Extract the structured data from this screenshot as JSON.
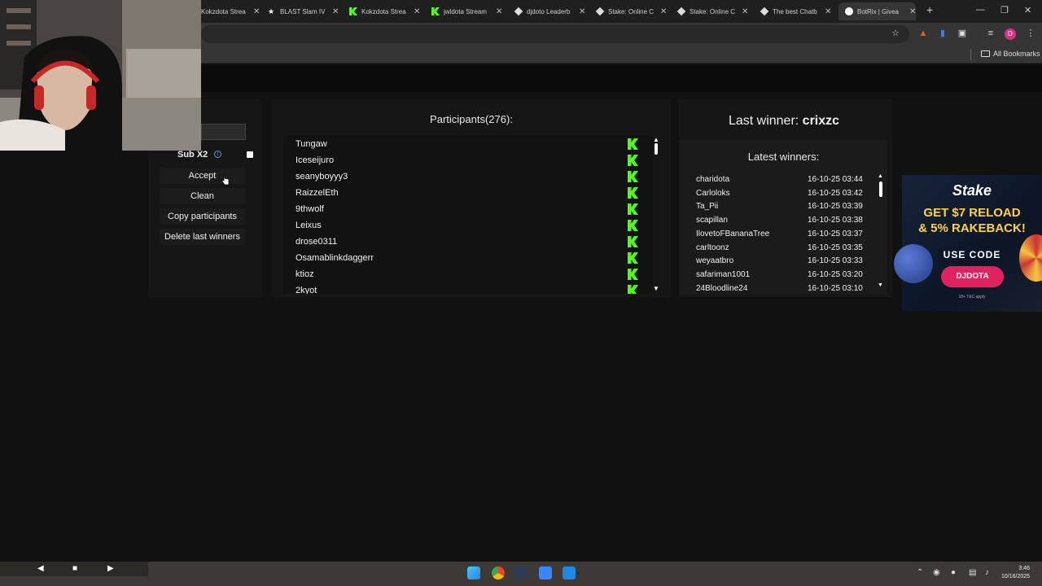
{
  "browser": {
    "tabs": [
      {
        "title": "Kokzdota Strea",
        "icon": "kick-icon"
      },
      {
        "title": "BLAST Slam IV",
        "icon": "blast-icon"
      },
      {
        "title": "Kokzdota Strea",
        "icon": "kick-icon"
      },
      {
        "title": "jwldota Stream",
        "icon": "kick-icon"
      },
      {
        "title": "djdoto Leaderb",
        "icon": "site-icon"
      },
      {
        "title": "Stake: Online C",
        "icon": "stake-icon"
      },
      {
        "title": "Stake: Online C",
        "icon": "stake-icon"
      },
      {
        "title": "The best Chatb",
        "icon": "site-icon"
      },
      {
        "title": "BotRix | Givea",
        "icon": "botrix-icon",
        "active": true
      }
    ],
    "new_tab": "+",
    "profile_initial": "D",
    "bookmarks_label": "All Bookmarks"
  },
  "controls": {
    "sub_x2_label": "Sub X2",
    "sub_x2_checked": true,
    "buttons": {
      "accept": "Accept",
      "clean": "Clean",
      "copy": "Copy participants",
      "delete": "Delete last winners"
    }
  },
  "participants": {
    "title": "Participants(276):",
    "names": [
      "Tungaw",
      "Iceseijuro",
      "seanyboyyy3",
      "RaizzelEth",
      "9thwolf",
      "Leixus",
      "drose0311",
      "Osamablinkdaggerr",
      "ktioz",
      "2kyot"
    ]
  },
  "winners": {
    "last_winner_label": "Last winner:",
    "last_winner_name": "crixzc",
    "latest_title": "Latest winners:",
    "list": [
      {
        "name": "charidota",
        "date": "16-10-25 03:44"
      },
      {
        "name": "Carloloks",
        "date": "16-10-25 03:42"
      },
      {
        "name": "Ta_Pii",
        "date": "16-10-25 03:39"
      },
      {
        "name": "scapillan",
        "date": "16-10-25 03:38"
      },
      {
        "name": "IlovetoFBananaTree",
        "date": "16-10-25 03:37"
      },
      {
        "name": "carltoonz",
        "date": "16-10-25 03:35"
      },
      {
        "name": "weyaatbro",
        "date": "16-10-25 03:33"
      },
      {
        "name": "safariman1001",
        "date": "16-10-25 03:20"
      },
      {
        "name": "24Bloodline24",
        "date": "16-10-25 03:10"
      }
    ]
  },
  "ad": {
    "logo": "Stake",
    "headline_1": "GET $7 RELOAD",
    "headline_2": "& 5% RAKEBACK!",
    "use_code": "USE CODE",
    "code": "DJDOTA",
    "terms": "18+  T&C apply"
  },
  "taskbar": {
    "time": "3:46",
    "date": "10/16/2025"
  },
  "colors": {
    "kick_green": "#53fc18",
    "stake_pink": "#e0235e",
    "ad_yellow": "#ffd23f",
    "panel_bg": "#161616"
  }
}
